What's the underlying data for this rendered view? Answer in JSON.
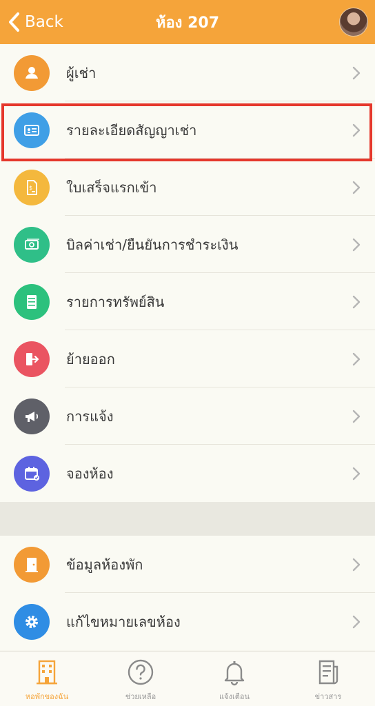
{
  "header": {
    "back_label": "Back",
    "title": "ห้อง 207"
  },
  "menu": [
    {
      "label": "ผู้เช่า",
      "icon": "person-icon",
      "color": "#f29a35"
    },
    {
      "label": "รายละเอียดสัญญาเช่า",
      "icon": "id-card-icon",
      "color": "#3f9fe6"
    },
    {
      "label": "ใบเสร็จแรกเข้า",
      "icon": "receipt-icon",
      "color": "#f4b83d"
    },
    {
      "label": "บิลค่าเช่า/ยืนยันการชำระเงิน",
      "icon": "money-icon",
      "color": "#2fbf88"
    },
    {
      "label": "รายการทรัพย์สิน",
      "icon": "cabinet-icon",
      "color": "#2cc17d"
    },
    {
      "label": "ย้ายออก",
      "icon": "exit-door-icon",
      "color": "#ea5461"
    },
    {
      "label": "การแจ้ง",
      "icon": "megaphone-icon",
      "color": "#5f6068"
    },
    {
      "label": "จองห้อง",
      "icon": "calendar-icon",
      "color": "#5d63e0"
    }
  ],
  "menu2": [
    {
      "label": "ข้อมูลห้องพัก",
      "icon": "door-icon",
      "color": "#f29a35"
    },
    {
      "label": "แก้ไขหมายเลขห้อง",
      "icon": "gear-icon",
      "color": "#2f8de4"
    }
  ],
  "tabs": [
    {
      "label": "หอพักของฉัน",
      "icon": "building-icon",
      "active": true
    },
    {
      "label": "ช่วยเหลือ",
      "icon": "help-icon",
      "active": false
    },
    {
      "label": "แจ้งเตือน",
      "icon": "bell-icon",
      "active": false
    },
    {
      "label": "ข่าวสาร",
      "icon": "news-icon",
      "active": false
    }
  ],
  "colors": {
    "header": "#f5a43a",
    "highlight": "#e5372b"
  }
}
